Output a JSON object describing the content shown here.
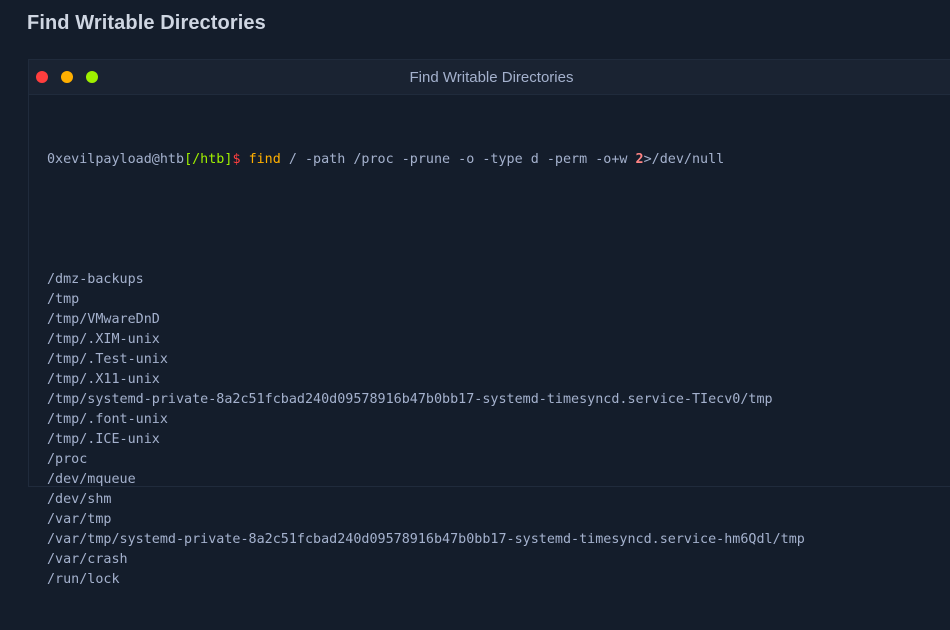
{
  "page": {
    "title": "Find Writable Directories"
  },
  "terminal": {
    "title": "Find Writable Directories",
    "prompt": {
      "user_host": "0xevilpayload@htb",
      "path": "[/htb]",
      "symbol": "$",
      "command": "find",
      "args_before": " / -path /proc -prune -o -type d -perm -o+w ",
      "fd": "2",
      "redirect": ">/dev/null"
    },
    "output": [
      "/dmz-backups",
      "/tmp",
      "/tmp/VMwareDnD",
      "/tmp/.XIM-unix",
      "/tmp/.Test-unix",
      "/tmp/.X11-unix",
      "/tmp/systemd-private-8a2c51fcbad240d09578916b47b0bb17-systemd-timesyncd.service-TIecv0/tmp",
      "/tmp/.font-unix",
      "/tmp/.ICE-unix",
      "/proc",
      "/dev/mqueue",
      "/dev/shm",
      "/var/tmp",
      "/var/tmp/systemd-private-8a2c51fcbad240d09578916b47b0bb17-systemd-timesyncd.service-hm6Qdl/tmp",
      "/var/crash",
      "/run/lock"
    ]
  },
  "colors": {
    "background": "#141d2b",
    "titlebar": "#1a2332",
    "text": "#a4b1cd",
    "green": "#9fef00",
    "red": "#ff3e3e",
    "yellow": "#ffaf00"
  }
}
